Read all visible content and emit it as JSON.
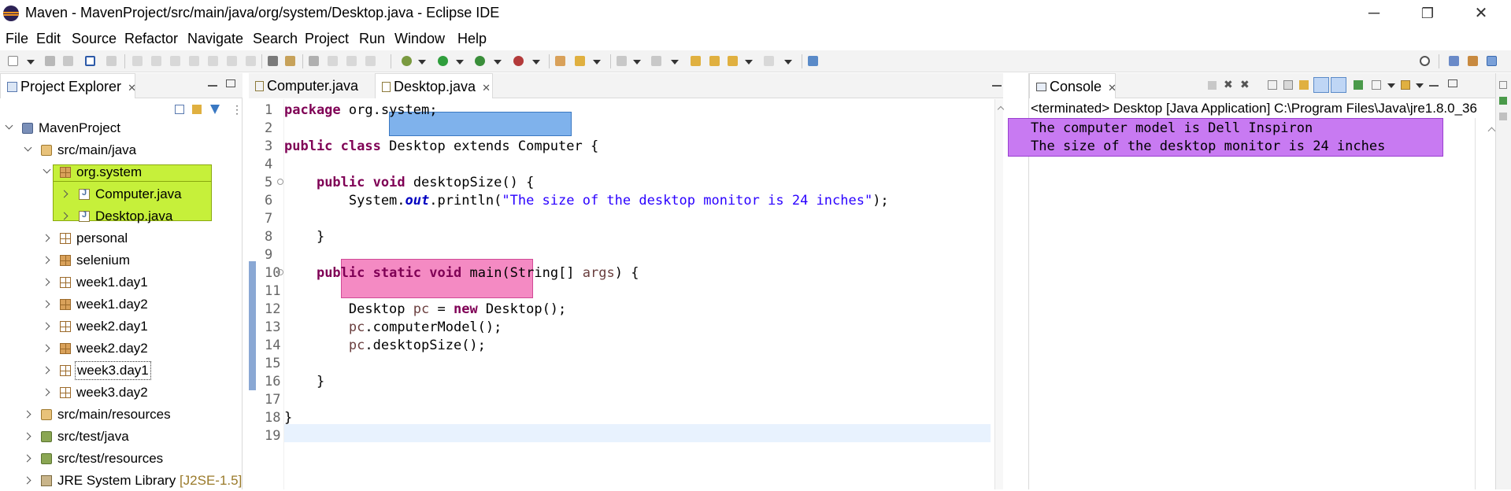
{
  "window": {
    "title": "Maven - MavenProject/src/main/java/org/system/Desktop.java - Eclipse IDE",
    "controls": {
      "minimize": "─",
      "restore": "❐",
      "close": "✕"
    }
  },
  "menu": [
    "File",
    "Edit",
    "Source",
    "Refactor",
    "Navigate",
    "Search",
    "Project",
    "Run",
    "Window",
    "Help"
  ],
  "explorer": {
    "title": "Project Explorer",
    "close": "✕",
    "tree": [
      {
        "label": "MavenProject",
        "icon": "project-icon"
      },
      {
        "label": "src/main/java",
        "icon": "source-folder-icon"
      },
      {
        "label": "org.system",
        "icon": "package-icon"
      },
      {
        "label": "Computer.java",
        "icon": "java-file-icon"
      },
      {
        "label": "Desktop.java",
        "icon": "java-file-icon"
      },
      {
        "label": "personal",
        "icon": "package-icon"
      },
      {
        "label": "selenium",
        "icon": "package-icon"
      },
      {
        "label": "week1.day1",
        "icon": "package-icon"
      },
      {
        "label": "week1.day2",
        "icon": "package-icon"
      },
      {
        "label": "week2.day1",
        "icon": "package-icon"
      },
      {
        "label": "week2.day2",
        "icon": "package-icon"
      },
      {
        "label": "week3.day1",
        "icon": "package-icon"
      },
      {
        "label": "week3.day2",
        "icon": "package-icon"
      },
      {
        "label": "src/main/resources",
        "icon": "source-folder-icon"
      },
      {
        "label": "src/test/java",
        "icon": "source-folder-icon"
      },
      {
        "label": "src/test/resources",
        "icon": "source-folder-icon"
      },
      {
        "label": "JRE System Library",
        "suffix": "[J2SE-1.5]",
        "icon": "library-icon"
      }
    ]
  },
  "editor": {
    "tabs": [
      {
        "label": "Computer.java",
        "active": false
      },
      {
        "label": "Desktop.java",
        "active": true,
        "close": "✕"
      }
    ],
    "line_numbers": [
      "1",
      "2",
      "3",
      "4",
      "5",
      "6",
      "7",
      "8",
      "9",
      "10",
      "11",
      "12",
      "13",
      "14",
      "15",
      "16",
      "17",
      "18",
      "19"
    ],
    "code": {
      "l1_kw": "package",
      "l1_rest": " org.system;",
      "l3_kw1": "public",
      "l3_kw2": "class",
      "l3_sel": "Desktop extends Computer",
      "l3_brace": " {",
      "l5_ind": "    ",
      "l5_kw1": "public",
      "l5_kw2": "void",
      "l5_rest": " desktopSize() {",
      "l6_a": "        System.",
      "l6_out": "out",
      "l6_b": ".println(",
      "l6_str": "\"The size of the desktop monitor is 24 inches\"",
      "l6_c": ");",
      "l8": "    }",
      "l10_ind": "    ",
      "l10_kw1": "public",
      "l10_kw2": "static",
      "l10_kw3": "void",
      "l10_a": " main(String[] ",
      "l10_args": "args",
      "l10_b": ") {",
      "l12_a": "        Desktop ",
      "l12_pc": "pc",
      "l12_b": " = ",
      "l12_kw": "new",
      "l12_c": " Desktop();",
      "l13_ind": "        ",
      "l13_pc": "pc",
      "l13_rest": ".computerModel();",
      "l14_ind": "        ",
      "l14_pc": "pc",
      "l14_rest": ".desktopSize();",
      "l16": "    }",
      "l18": "}"
    }
  },
  "console": {
    "title": "Console",
    "close": "✕",
    "header": "<terminated> Desktop [Java Application] C:\\Program Files\\Java\\jre1.8.0_36",
    "output": [
      "The computer model is Dell Inspiron",
      "The size of the desktop monitor is 24 inches"
    ]
  },
  "colors": {
    "highlight_green": "#c6f03a",
    "highlight_blue": "#7fb2ec",
    "highlight_pink": "#f48ac3",
    "highlight_purple": "#c87af2",
    "keyword": "#7f0055",
    "string": "#2a00ff"
  }
}
